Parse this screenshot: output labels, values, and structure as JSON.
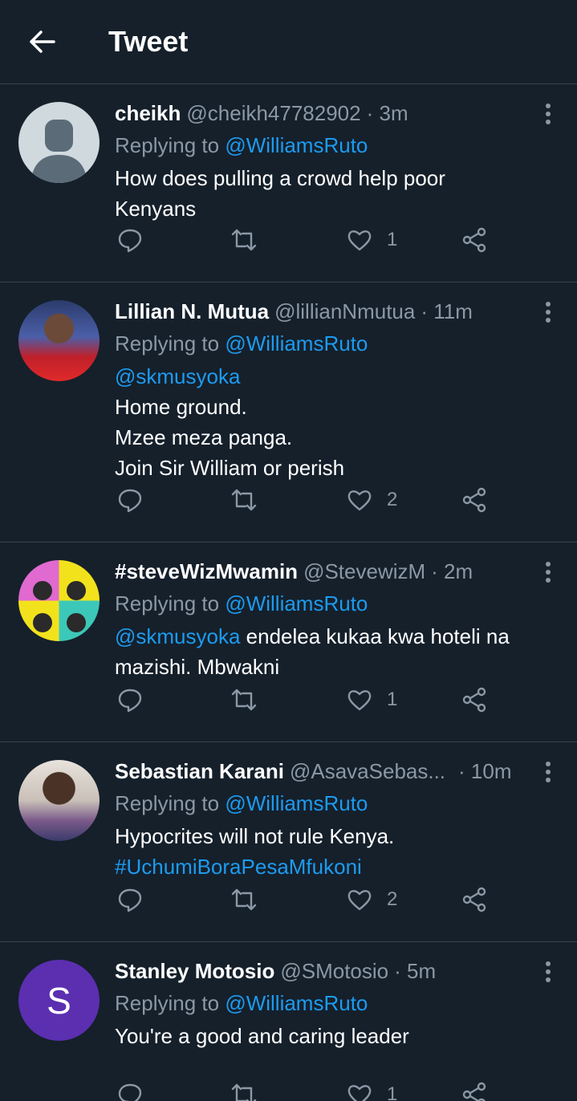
{
  "header": {
    "title": "Tweet"
  },
  "colors": {
    "background": "#15202b",
    "link": "#1d9bf0",
    "muted": "#8b98a5",
    "divider": "#38444d"
  },
  "tweets": [
    {
      "name": "cheikh",
      "handle": "@cheikh47782902",
      "time": "· 3m",
      "reply_prefix": "Replying to",
      "reply_to": "@WilliamsRuto",
      "lines": [
        "How does pulling a crowd help poor",
        "Kenyans"
      ],
      "likes": "1",
      "avatar": "default-avatar"
    },
    {
      "name": "Lillian N. Mutua",
      "handle": "@lillianNmutua",
      "time": "· 11m",
      "reply_prefix": "Replying to",
      "reply_to": "@WilliamsRuto",
      "mention": "@skmusyoka",
      "lines": [
        "Home ground.",
        "Mzee meza panga.",
        "Join Sir William or perish"
      ],
      "likes": "2",
      "avatar": "photo-avatar"
    },
    {
      "name": "#steveWizMwamin",
      "handle": "@StevewizM",
      "time": "· 2m",
      "reply_prefix": "Replying to",
      "reply_to": "@WilliamsRuto",
      "mention": "@skmusyoka",
      "line1_rest": "endelea kukaa kwa hoteli na",
      "line2": "mazishi. Mbwakni",
      "likes": "1",
      "avatar": "pop-art-avatar"
    },
    {
      "name": "Sebastian Karani",
      "handle": "@AsavaSebas...",
      "time": "· 10m",
      "reply_prefix": "Replying to",
      "reply_to": "@WilliamsRuto",
      "line1": "Hypocrites will not rule Kenya.",
      "hashtag": "#UchumiBoraPesaMfukoni",
      "likes": "2",
      "avatar": "photo-avatar"
    },
    {
      "name": "Stanley Motosio",
      "handle": "@SMotosio",
      "time": "· 5m",
      "reply_prefix": "Replying to",
      "reply_to": "@WilliamsRuto",
      "line1": "You're a good and caring leader",
      "likes": "1",
      "avatar_letter": "S"
    }
  ]
}
